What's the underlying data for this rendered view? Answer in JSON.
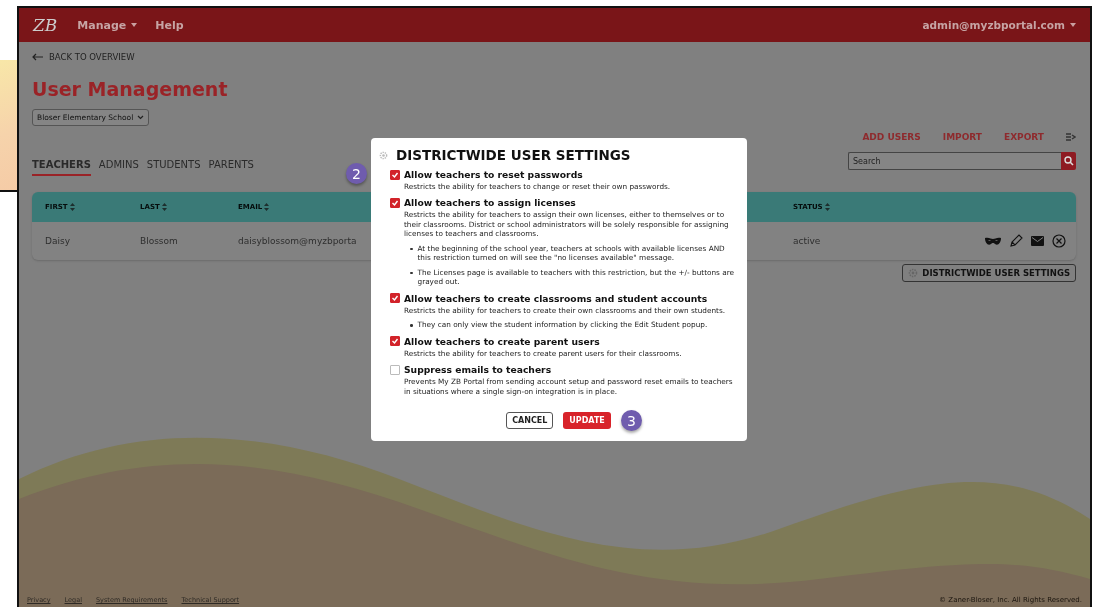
{
  "header": {
    "logo": "ZB",
    "menu": [
      {
        "label": "Manage",
        "dropdown": true
      },
      {
        "label": "Help",
        "dropdown": false
      }
    ],
    "account": "admin@myzbportal.com"
  },
  "back_link": "BACK TO OVERVIEW",
  "title": "User Management",
  "school_select": "Bloser Elementary School",
  "tabs": [
    {
      "label": "TEACHERS",
      "selected": true
    },
    {
      "label": "ADMINS",
      "selected": false
    },
    {
      "label": "STUDENTS",
      "selected": false
    },
    {
      "label": "PARENTS",
      "selected": false
    }
  ],
  "actions": [
    "ADD USERS",
    "IMPORT",
    "EXPORT"
  ],
  "search": {
    "placeholder": "Search"
  },
  "table": {
    "columns": [
      "FIRST",
      "LAST",
      "EMAIL",
      "STATUS"
    ],
    "rows": [
      {
        "first": "Daisy",
        "last": "Blossom",
        "email": "daisyblossom@myzbporta",
        "status": "active"
      }
    ]
  },
  "settings_button": "DISTRICTWIDE USER SETTINGS",
  "modal": {
    "title": "DISTRICTWIDE USER SETTINGS",
    "settings": [
      {
        "label": "Allow teachers to reset passwords",
        "checked": true,
        "description": "Restricts the ability for teachers to change or reset their own passwords."
      },
      {
        "label": "Allow teachers to assign licenses",
        "checked": true,
        "description": "Restricts the ability for teachers to assign their own licenses, either to themselves or to their classrooms. District or school administrators will be solely responsible for assigning licenses to teachers and classrooms.",
        "bullets": [
          "At the beginning of the school year, teachers at schools with available licenses AND this restriction turned on will see the \"no licenses available\" message.",
          "The Licenses page is available to teachers with this restriction, but the +/- buttons are grayed out."
        ]
      },
      {
        "label": "Allow teachers to create classrooms and student accounts",
        "checked": true,
        "description": "Restricts the ability for teachers to create their own classrooms and their own students.",
        "bullets": [
          "They can only view the student information by clicking the Edit Student popup."
        ]
      },
      {
        "label": "Allow teachers to create parent users",
        "checked": true,
        "description": "Restricts the ability for teachers to create parent users for their classrooms."
      },
      {
        "label": "Suppress emails to teachers",
        "checked": false,
        "description": "Prevents My ZB Portal from sending account setup and password reset emails to teachers in situations where a single sign-on integration is in place."
      }
    ],
    "cancel": "CANCEL",
    "update": "UPDATE"
  },
  "annotations": [
    "2",
    "3"
  ],
  "footer": {
    "links": [
      "Privacy",
      "Legal",
      "System Requirements",
      "Technical Support"
    ],
    "copyright": "© Zaner-Bloser, Inc. All Rights Reserved."
  }
}
